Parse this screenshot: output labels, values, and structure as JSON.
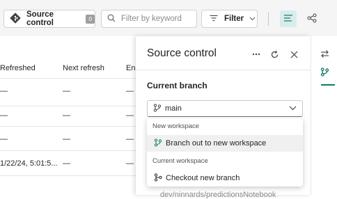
{
  "toolbar": {
    "source_control_label": "Source control",
    "source_control_count": "0",
    "search_placeholder": "Filter by keyword",
    "filter_label": "Filter"
  },
  "table": {
    "headers": [
      "Refreshed",
      "Next refresh",
      "En"
    ],
    "rows": [
      {
        "refreshed": "—",
        "next_refresh": "—",
        "en": "—"
      },
      {
        "refreshed": "—",
        "next_refresh": "—",
        "en": "—"
      },
      {
        "refreshed": "—",
        "next_refresh": "—",
        "en": "—"
      },
      {
        "refreshed": "1/22/24, 5:01:5...",
        "next_refresh": "—",
        "en": "—"
      }
    ]
  },
  "panel": {
    "title": "Source control",
    "section_title": "Current branch",
    "branch_value": "main",
    "partial_text": "dev/ninnards/predictionsNotebook"
  },
  "menu": {
    "group1": "New workspace",
    "item1": "Branch out to new workspace",
    "group2": "Current workspace",
    "item2": "Checkout new branch"
  },
  "colors": {
    "accent": "#117865",
    "badge": "#9e9e9e",
    "active_view_bg": "#d9ecec"
  },
  "icons": [
    "source-control-diamond-icon",
    "search-icon",
    "filter-icon",
    "chevron-down-icon",
    "list-view-icon",
    "lineage-view-icon",
    "more-icon",
    "refresh-icon",
    "close-icon",
    "branch-icon",
    "swap-icon"
  ]
}
